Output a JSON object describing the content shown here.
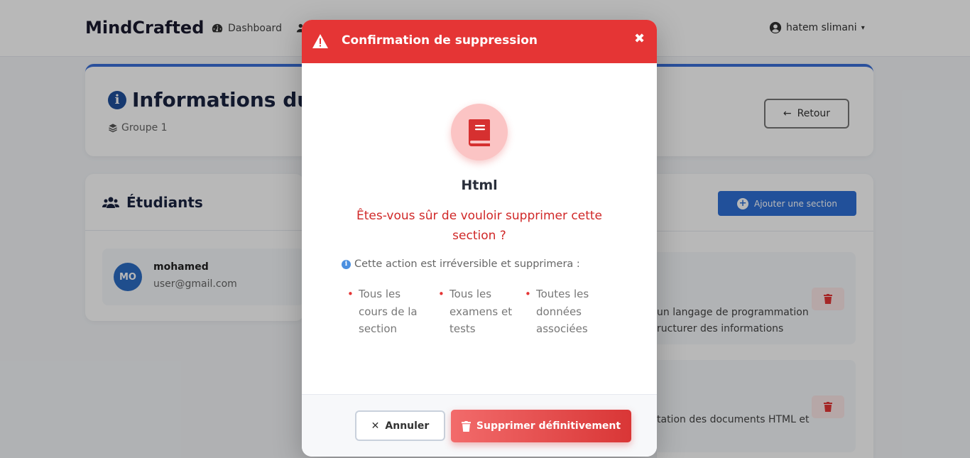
{
  "navbar": {
    "brand": "MindCrafted",
    "links": [
      {
        "label": "Dashboard",
        "icon": "dashboard-icon"
      },
      {
        "label": "",
        "icon": "users-icon"
      }
    ],
    "user": {
      "name": "hatem slimani",
      "icon": "user-circle-icon"
    }
  },
  "info_card": {
    "title": "Informations du",
    "group": "Groupe 1",
    "back_button": "Retour"
  },
  "students": {
    "title": "Étudiants",
    "items": [
      {
        "initials": "MO",
        "name": "mohamed",
        "email": "user@gmail.com"
      }
    ]
  },
  "sections": {
    "add_button": "Ajouter une section",
    "items": [
      {
        "desc_line1": "un langage de programmation",
        "desc_line2": "ructurer des informations"
      },
      {
        "desc_line1": "tation des documents HTML et",
        "desc_line2": ""
      }
    ]
  },
  "modal": {
    "title": "Confirmation de suppression",
    "close_symbol": "✖",
    "section_name": "Html",
    "question": "Êtes-vous sûr de vouloir supprimer cette section ?",
    "note": "Cette action est irréversible et supprimera :",
    "consequences": [
      [
        "Tous les",
        "cours de la",
        "section"
      ],
      [
        "Tous les",
        "examens et",
        "tests"
      ],
      [
        "Toutes les",
        "données",
        "associées"
      ]
    ],
    "cancel_label": "Annuler",
    "delete_label": "Supprimer définitivement"
  },
  "colors": {
    "danger": "#e53535",
    "primary": "#2e6fd6",
    "avatar": "#2c6cc4",
    "question_text": "#d02828"
  }
}
